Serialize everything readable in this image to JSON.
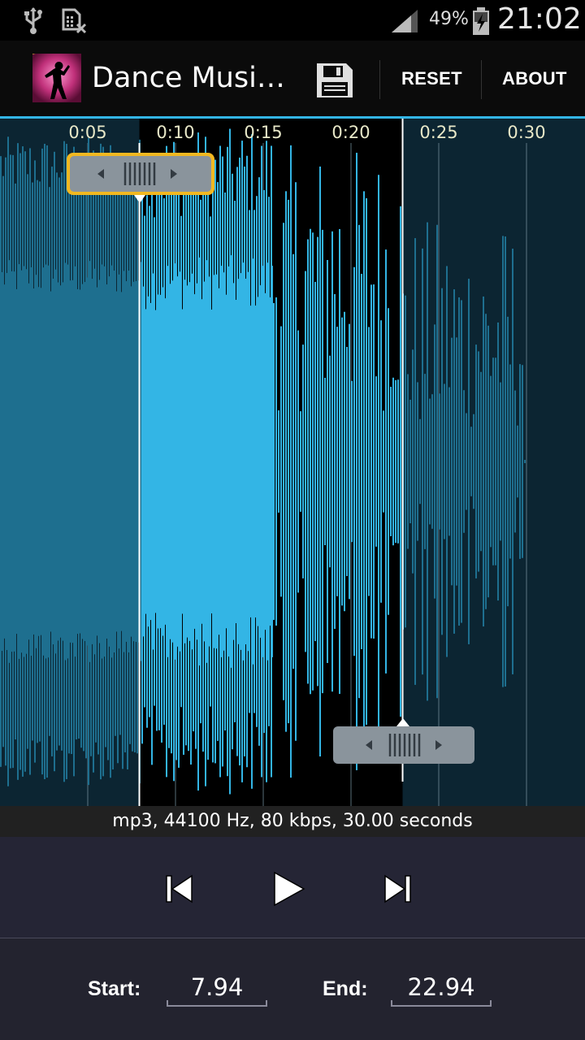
{
  "status_bar": {
    "battery_percent": "49%",
    "time": "21:02",
    "icons": [
      "usb-icon",
      "no-sim-icon",
      "signal-icon",
      "battery-charging-icon"
    ]
  },
  "action_bar": {
    "title": "Dance Musi…",
    "save_icon": "floppy-disk-icon",
    "reset_label": "RESET",
    "about_label": "ABOUT"
  },
  "waveform": {
    "time_labels": [
      "0:05",
      "0:10",
      "0:15",
      "0:20",
      "0:25",
      "0:30"
    ],
    "selection_start_seconds": 7.94,
    "selection_end_seconds": 22.94,
    "duration_seconds": 30.0,
    "colors": {
      "selected_wave": "#33b5e5",
      "unselected_wave": "#1e6f8f",
      "background_selected": "#000000",
      "background_unselected": "#0c2532",
      "focused_marker_border": "#f2b820"
    }
  },
  "info": {
    "text": "mp3, 44100 Hz, 80 kbps, 30.00 seconds"
  },
  "controls": {
    "icons": [
      "rewind-icon",
      "play-icon",
      "fast-forward-icon"
    ]
  },
  "times": {
    "start_label": "Start:",
    "start_value": "7.94",
    "end_label": "End:",
    "end_value": "22.94"
  }
}
